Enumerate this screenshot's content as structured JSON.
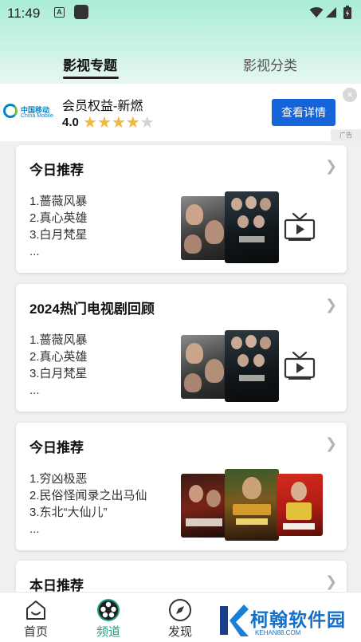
{
  "status_bar": {
    "time": "11:49",
    "notification_letter": "A"
  },
  "tabs": [
    {
      "label": "影视专题",
      "active": true
    },
    {
      "label": "影视分类",
      "active": false
    }
  ],
  "ad": {
    "brand_cn": "中国移动",
    "brand_en": "China Mobile",
    "title": "会员权益-新燃",
    "rating": "4.0",
    "stars_filled": 4,
    "stars_total": 5,
    "button_label": "查看详情",
    "close_label": "×",
    "tag": "广告"
  },
  "cards": [
    {
      "title": "今日推荐",
      "items": [
        "1.蔷薇风暴",
        "2.真心英雄",
        "3.白月梵星",
        "..."
      ]
    },
    {
      "title": "2024热门电视剧回顾",
      "items": [
        "1.蔷薇风暴",
        "2.真心英雄",
        "3.白月梵星",
        "..."
      ]
    },
    {
      "title": "今日推荐",
      "items": [
        "1.穷凶极恶",
        "2.民俗怪闻录之出马仙",
        "3.东北“大仙儿”",
        "..."
      ]
    },
    {
      "title": "本日推荐",
      "items": []
    }
  ],
  "bottom_nav": [
    {
      "label": "首页",
      "icon": "home-icon",
      "active": false
    },
    {
      "label": "频道",
      "icon": "film-reel-icon",
      "active": true
    },
    {
      "label": "发现",
      "icon": "compass-icon",
      "active": false
    }
  ],
  "watermark": {
    "name": "柯翰软件园",
    "url": "KEHAN88.COM"
  },
  "colors": {
    "accent": "#1aa386",
    "ad_button": "#1565d8",
    "star": "#f1b83a"
  }
}
